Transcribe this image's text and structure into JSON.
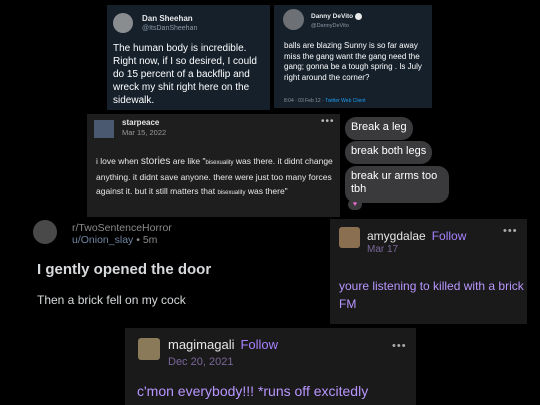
{
  "tweet1": {
    "name": "Dan Sheehan",
    "handle": "@ItsDanSheehan",
    "text": "The human body is incredible. Right now, if I so desired, I could do 15 percent of a backflip and wreck my shit right here on the sidewalk."
  },
  "tweet2": {
    "name": "Danny DeVito",
    "handle": "@DannyDeVito",
    "text": "balls are blazing Sunny is so far away miss the gang want the gang need the gang; gonna be a tough spring . Is July right around the corner?",
    "timestamp": "8:04 · 03 Feb 12 · ",
    "client": "Twitter Web Client",
    "icons": {
      "verified": "verified-badge-icon"
    }
  },
  "starpeace": {
    "username": "starpeace",
    "date": "Mar 15, 2022",
    "menu": "•••",
    "text_1": "i love when",
    "text_2": "stories",
    "text_3": "are like \"",
    "text_4": "bisexuality",
    "text_5": "was there. it didnt change anything. it didnt save anyone. there were just too many forces against it. but it still matters that",
    "text_6": "bisexuality",
    "text_7": "was there\""
  },
  "chat": {
    "bubble_1": "Break a leg",
    "bubble_2": "break both legs",
    "bubble_3": "break ur arms too tbh",
    "reaction": "♥",
    "colors": {
      "bubble": "#3a3a3c",
      "reaction": "#f06ad0"
    }
  },
  "reddit": {
    "subreddit": "r/TwoSentenceHorror",
    "user": "u/Onion_slay",
    "separator": " • ",
    "age": "5m",
    "title": "I gently opened the door",
    "body": "Then a brick fell on my cock"
  },
  "amygdalae": {
    "username": "amygdalae",
    "follow": "Follow",
    "date": "Mar 17",
    "menu": "•••",
    "text": "youre listening to killed with a brick FM",
    "colors": {
      "accent": "#a781ff"
    }
  },
  "magimagali": {
    "username": "magimagali",
    "follow": "Follow",
    "date": "Dec 20, 2021",
    "menu": "•••",
    "text": "c'mon everybody!!! *runs off excitedly",
    "colors": {
      "accent": "#a781ff"
    }
  }
}
